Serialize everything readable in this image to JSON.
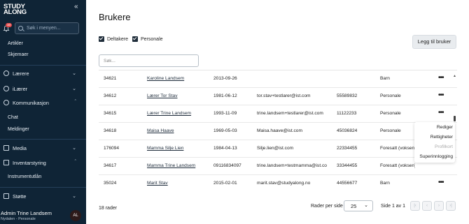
{
  "sidebar": {
    "logo": "STUDY ALONG",
    "collapse_icon": "double-chevron-left-icon",
    "notification_count": "10",
    "search_placeholder": "Søk i menyen...",
    "sub_items_top": [
      "Artikler",
      "Skjemaer"
    ],
    "sections": {
      "laerere": "Lærere",
      "ilaerer": "iLærer",
      "kommunikasjon": "Kommunikasjon",
      "media": "Media",
      "inventarstyring": "Inventarstyring",
      "stotte": "Støtte"
    },
    "kommunikasjon_items": [
      "Chat",
      "Meldinger"
    ],
    "inventar_items": [
      "Instrumentutlån"
    ],
    "user": {
      "name": "Admin Trine Landsem",
      "subtitle": "Nydalen - Personale",
      "initials": "AL"
    }
  },
  "main": {
    "title": "Brukere",
    "add_button": "Legg til bruker",
    "filters": [
      "Deltakere",
      "Personale"
    ],
    "search_placeholder": "Søk...",
    "rows": [
      {
        "id": "34621",
        "name": "Karoline Landsem",
        "birth": "2013-09-26",
        "email": "",
        "phone": "",
        "role": "Barn"
      },
      {
        "id": "34612",
        "name": "Lærer Tor Stav",
        "birth": "1981-06-12",
        "email": "tor.stav+testlarer@ist.com",
        "phone": "55589832",
        "role": "Personale"
      },
      {
        "id": "34615",
        "name": "Lærer Trine Landsem",
        "birth": "1993-11-09",
        "email": "trine.landsem+testlarer@ist.com",
        "phone": "11122233",
        "role": "Personale"
      },
      {
        "id": "34618",
        "name": "Maisa Haave",
        "birth": "1969-05-03",
        "email": "Maisa.haave@ist.com",
        "phone": "45036824",
        "role": "Personale"
      },
      {
        "id": "176094",
        "name": "Mamma Silje Lien",
        "birth": "1984-04-13",
        "email": "Silje.lien@ist.com",
        "phone": "22334455",
        "role": "Foresatt (voksen)"
      },
      {
        "id": "34617",
        "name": "Mamma Trine Landsem",
        "birth": "09116834097",
        "email": "trine.landsem+testmamma@ist.com",
        "phone": "33344455",
        "role": "Foresatt (voksen)"
      },
      {
        "id": "35024",
        "name": "Marit Stav",
        "birth": "2015-02-01",
        "email": "marit.stav@studyalong.no",
        "phone": "44556677",
        "role": "Barn"
      }
    ],
    "context_menu": [
      "Rediger",
      "Rettigheter",
      "Profilkort",
      "Superinnlogging"
    ],
    "footer": {
      "count": "18 rader",
      "rows_per_page_label": "Rader per side",
      "rows_per_page_value": "25",
      "page_label": "Side 1 av 1"
    }
  }
}
